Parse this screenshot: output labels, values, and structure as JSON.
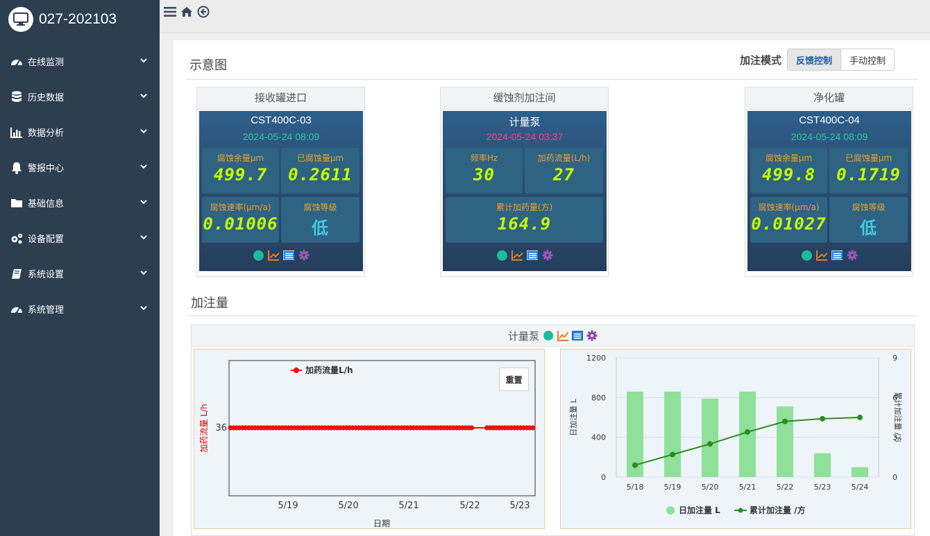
{
  "app": {
    "title": "027-202103"
  },
  "sidebar": {
    "items": [
      {
        "label": "在线监测",
        "icon": "dashboard-icon"
      },
      {
        "label": "历史数据",
        "icon": "database-icon"
      },
      {
        "label": "数据分析",
        "icon": "bar-chart-icon"
      },
      {
        "label": "警报中心",
        "icon": "bell-icon"
      },
      {
        "label": "基础信息",
        "icon": "folder-icon"
      },
      {
        "label": "设备配置",
        "icon": "gears-icon"
      },
      {
        "label": "系统设置",
        "icon": "book-icon"
      },
      {
        "label": "系统管理",
        "icon": "dashboard-icon"
      }
    ]
  },
  "schematic": {
    "title": "示意图",
    "mode_label": "加注模式",
    "mode_buttons": [
      "反馈控制",
      "手动控制"
    ],
    "active_mode": "反馈控制"
  },
  "panels": [
    {
      "header": "接收罐进口",
      "device": "CST400C-03",
      "time": "2024-05-24 08:09",
      "time_color": "#2ecc9a",
      "cells": [
        {
          "label": "腐蚀余量μm",
          "value": "499.7"
        },
        {
          "label": "已腐蚀量μm",
          "value": "0.2611"
        },
        {
          "label": "腐蚀速率(μm/a)",
          "value": "0.01006"
        },
        {
          "label": "腐蚀等级",
          "value": "低"
        }
      ]
    },
    {
      "header": "缓蚀剂加注间",
      "device": "计量泵",
      "time": "2024-05-24 03:37",
      "time_color": "#ff3c8a",
      "cells": [
        {
          "label": "频率Hz",
          "value": "30"
        },
        {
          "label": "加药流量(L/h)",
          "value": "27"
        },
        {
          "label": "累计加药量(方)",
          "value": "164.9"
        }
      ]
    },
    {
      "header": "净化罐",
      "device": "CST400C-04",
      "time": "2024-05-24 08:09",
      "time_color": "#2ecc9a",
      "cells": [
        {
          "label": "腐蚀余量μm",
          "value": "499.8"
        },
        {
          "label": "已腐蚀量μm",
          "value": "0.1719"
        },
        {
          "label": "腐蚀速率(μm/a)",
          "value": "0.01027"
        },
        {
          "label": "腐蚀等级",
          "value": "低"
        }
      ]
    }
  ],
  "dosing": {
    "title": "加注量",
    "chart_header": "计量泵",
    "reset_label": "重置"
  },
  "chart_data": [
    {
      "type": "line",
      "legend": "加药流量L/h",
      "ylabel": "加药流量 L/h",
      "xlabel": "日期",
      "x_ticks": [
        "5/19",
        "5/20",
        "5/21",
        "5/22",
        "5/23"
      ],
      "y_ticks": [
        "36"
      ],
      "value": 36,
      "color": "#ee1111"
    },
    {
      "type": "bar",
      "categories": [
        "5/18",
        "5/19",
        "5/20",
        "5/21",
        "5/22",
        "5/23",
        "5/24"
      ],
      "series": [
        {
          "name": "日加注量 L",
          "type": "bar",
          "values": [
            860,
            860,
            790,
            860,
            710,
            240,
            100
          ],
          "color": "#8fe098"
        },
        {
          "name": "累计加注量 /方",
          "type": "line",
          "values": [
            0.9,
            1.7,
            2.5,
            3.4,
            4.2,
            4.4,
            4.5
          ],
          "color": "#2e8b1e"
        }
      ],
      "ylabel": "日加注量 L",
      "ylabel2": "累计加注量 /方",
      "ylim": [
        0,
        1200
      ],
      "ylim2": [
        0,
        9
      ],
      "y_ticks": [
        "0",
        "400",
        "800",
        "1200"
      ],
      "y2_ticks": [
        "0",
        "3",
        "6",
        "9"
      ]
    }
  ]
}
